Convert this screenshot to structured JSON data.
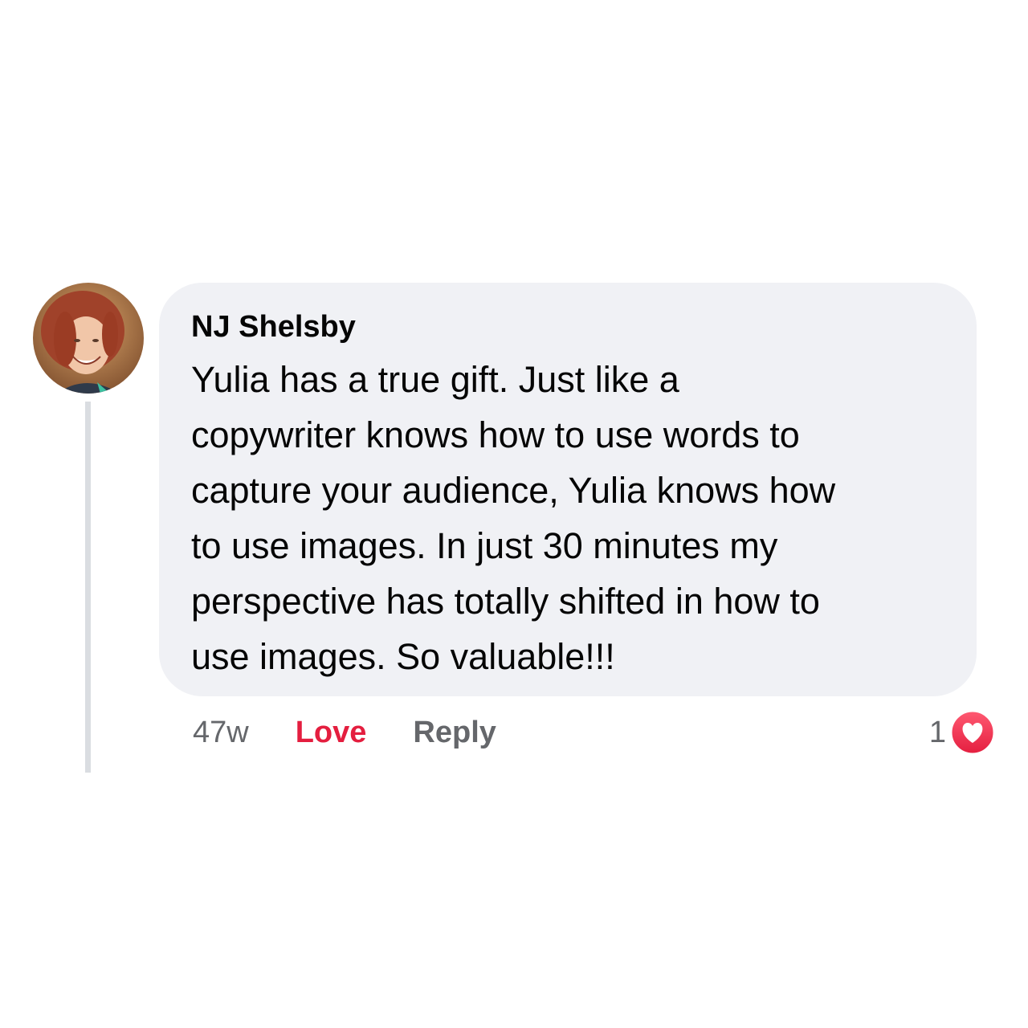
{
  "comment": {
    "author": "NJ Shelsby",
    "text": "Yulia has a true gift. Just like a\ncopywriter knows how to use words to\ncapture your audience, Yulia knows how\nto use images. In just 30 minutes my\nperspective has totally shifted in how to\nuse images. So valuable!!!",
    "avatar_icon": "user-avatar-photo"
  },
  "actions": {
    "timestamp": "47w",
    "love_label": "Love",
    "reply_label": "Reply"
  },
  "reactions": {
    "count": "1",
    "icon": "heart-icon"
  },
  "colors": {
    "bubble_bg": "#f0f1f5",
    "love_red": "#e41e3f",
    "muted_text": "#65676b",
    "thread_line": "#dadde1"
  }
}
